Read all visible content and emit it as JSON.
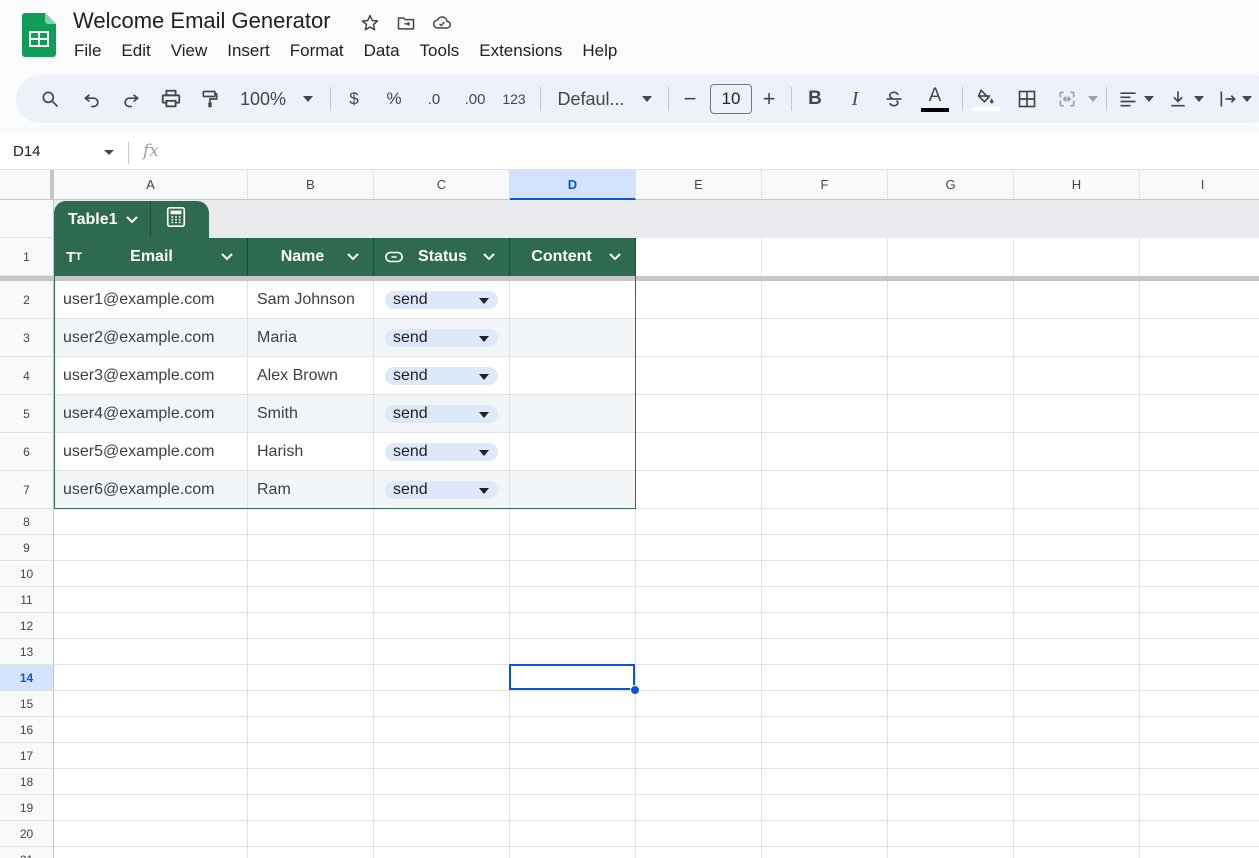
{
  "app": {
    "title": "Welcome Email Generator",
    "menu": [
      "File",
      "Edit",
      "View",
      "Insert",
      "Format",
      "Data",
      "Tools",
      "Extensions",
      "Help"
    ]
  },
  "toolbar": {
    "zoom": "100%",
    "currency": "$",
    "percent": "%",
    "dec_decrease": ".0",
    "dec_increase": ".00",
    "number_format": "123",
    "font": "Defaul...",
    "font_size": "10",
    "minus": "−",
    "plus": "+",
    "bold": "B",
    "italic": "I",
    "text_color_letter": "A"
  },
  "formula_bar": {
    "name_box": "D14",
    "fx": "fx",
    "content": ""
  },
  "columns": [
    "A",
    "B",
    "C",
    "D",
    "E",
    "F",
    "G",
    "H",
    "I"
  ],
  "selected_column": "D",
  "rows": [
    "1",
    "2",
    "3",
    "4",
    "5",
    "6",
    "7",
    "8",
    "9",
    "10",
    "11",
    "12",
    "13",
    "14",
    "15",
    "16",
    "17",
    "18",
    "19",
    "20",
    "21"
  ],
  "selected_row": "14",
  "table": {
    "name": "Table1",
    "headers": [
      "Email",
      "Name",
      "Status",
      "Content"
    ],
    "rows": [
      {
        "email": "user1@example.com",
        "name": "Sam Johnson",
        "status": "send",
        "content": ""
      },
      {
        "email": "user2@example.com",
        "name": "Maria",
        "status": "send",
        "content": ""
      },
      {
        "email": "user3@example.com",
        "name": "Alex Brown",
        "status": "send",
        "content": ""
      },
      {
        "email": "user4@example.com",
        "name": "Smith",
        "status": "send",
        "content": ""
      },
      {
        "email": "user5@example.com",
        "name": "Harish",
        "status": "send",
        "content": ""
      },
      {
        "email": "user6@example.com",
        "name": "Ram",
        "status": "send",
        "content": ""
      }
    ]
  },
  "colors": {
    "table_header": "#2d6a4f",
    "selection": "#0b57d0",
    "chip": "#dde9fb",
    "toolbar_bg": "#edf2fa"
  }
}
